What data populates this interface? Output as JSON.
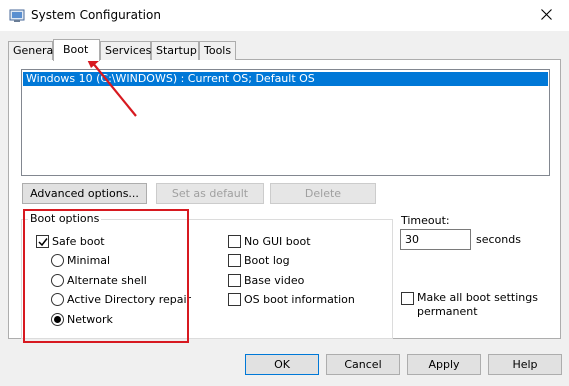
{
  "window": {
    "title": "System Configuration"
  },
  "icons": {
    "app": "msconfig-icon",
    "close": "close-icon"
  },
  "tabs": [
    {
      "label": "General",
      "active": false
    },
    {
      "label": "Boot",
      "active": true
    },
    {
      "label": "Services",
      "active": false
    },
    {
      "label": "Startup",
      "active": false
    },
    {
      "label": "Tools",
      "active": false
    }
  ],
  "os_list": {
    "items": [
      "Windows 10 (C:\\WINDOWS) : Current OS; Default OS"
    ]
  },
  "list_buttons": {
    "advanced": "Advanced options...",
    "set_default": "Set as default",
    "delete": "Delete"
  },
  "boot_options": {
    "group_label": "Boot options",
    "safe_boot": {
      "label": "Safe boot",
      "checked": true
    },
    "radios": [
      {
        "label": "Minimal",
        "selected": false
      },
      {
        "label": "Alternate shell",
        "selected": false
      },
      {
        "label": "Active Directory repair",
        "selected": false
      },
      {
        "label": "Network",
        "selected": true
      }
    ],
    "checkboxes": [
      {
        "label": "No GUI boot",
        "checked": false
      },
      {
        "label": "Boot log",
        "checked": false
      },
      {
        "label": "Base video",
        "checked": false
      },
      {
        "label": "OS boot information",
        "checked": false
      }
    ]
  },
  "timeout": {
    "label": "Timeout:",
    "value": "30",
    "unit": "seconds"
  },
  "permanent": {
    "line1": "Make all boot settings",
    "line2": "permanent",
    "checked": false
  },
  "footer": {
    "ok": "OK",
    "cancel": "Cancel",
    "apply": "Apply",
    "help": "Help"
  },
  "colors": {
    "selection": "#0078d7",
    "annotation": "#d71920"
  }
}
